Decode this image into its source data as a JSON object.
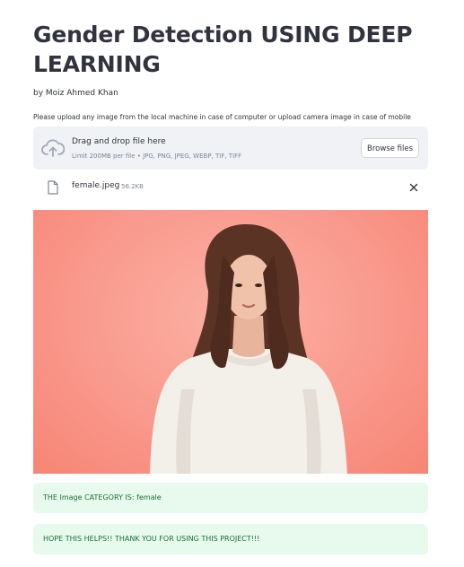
{
  "page": {
    "title": "Gender Detection USING DEEP LEARNING",
    "author": "by Moiz Ahmed Khan",
    "instructions": "Please upload any image from the local machine in case of computer or upload camera image in case of mobile"
  },
  "uploader": {
    "drop_title": "Drag and drop file here",
    "limit_text": "Limit 200MB per file • JPG, PNG, JPEG, WEBP, TIF, TIFF",
    "browse_label": "Browse files",
    "icon": "cloud-upload-icon"
  },
  "uploaded_file": {
    "name": "female.jpeg",
    "size": "56.2KB",
    "icon": "file-icon"
  },
  "results": {
    "category_message": "THE Image CATEGORY IS: female",
    "thanks_message": "HOPE THIS HELPS!! THANK YOU FOR USING THIS PROJECT!!!"
  },
  "colors": {
    "photo_background": "#f9998d",
    "success_background": "#e8f9ee",
    "success_text": "#177233"
  }
}
